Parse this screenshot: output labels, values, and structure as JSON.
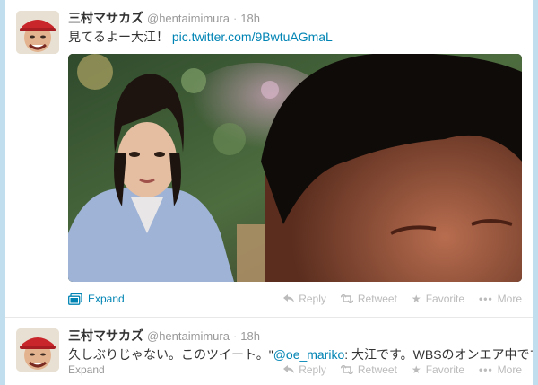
{
  "colors": {
    "link": "#0084b4",
    "muted": "#999999",
    "action": "#bbbbbb",
    "background": "#c0deed"
  },
  "tweets": [
    {
      "fullname": "三村マサカズ",
      "username": "@hentaimimura",
      "dot": "·",
      "time": "18h",
      "text": "見てるよー大江！",
      "link": "pic.twitter.com/9BwtuAGmaL",
      "media": "photo",
      "expand_label": "Expand",
      "actions": {
        "reply": "Reply",
        "retweet": "Retweet",
        "favorite": "Favorite",
        "more": "More"
      }
    },
    {
      "fullname": "三村マサカズ",
      "username": "@hentaimimura",
      "dot": "·",
      "time": "18h",
      "text_before": "久しぶりじゃない。このツイート。\"",
      "mention": "@oe_mariko",
      "text_after": ": 大江です。WBSのオンエア中です！\"",
      "expand_label": "Expand",
      "actions": {
        "reply": "Reply",
        "retweet": "Retweet",
        "favorite": "Favorite",
        "more": "More"
      }
    }
  ]
}
